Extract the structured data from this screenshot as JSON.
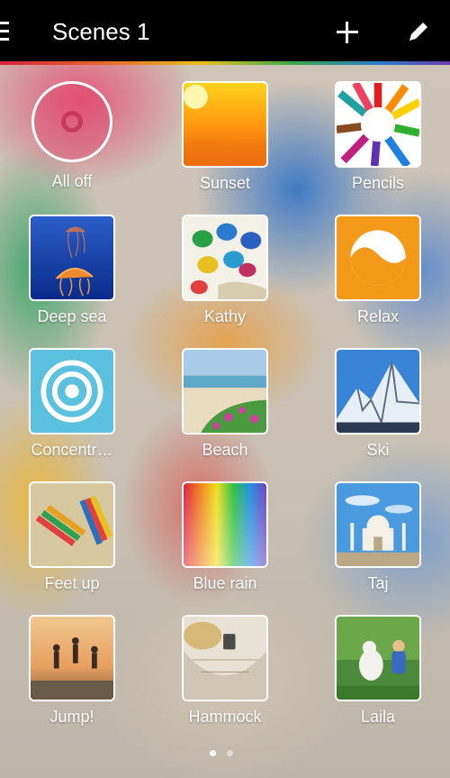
{
  "header": {
    "title": "Scenes 1",
    "icons": [
      "menu-icon",
      "add-icon",
      "edit-icon"
    ]
  },
  "scenes": [
    {
      "label": "All off",
      "icon": "power-off-icon"
    },
    {
      "label": "Sunset",
      "icon": "sunset-image"
    },
    {
      "label": "Pencils",
      "icon": "pencils-image"
    },
    {
      "label": "Deep sea",
      "icon": "jellyfish-image"
    },
    {
      "label": "Kathy",
      "icon": "handprints-image"
    },
    {
      "label": "Relax",
      "icon": "relax-icon"
    },
    {
      "label": "Concentr…",
      "icon": "concentrate-icon"
    },
    {
      "label": "Beach",
      "icon": "beach-image"
    },
    {
      "label": "Ski",
      "icon": "mountain-image"
    },
    {
      "label": "Feet up",
      "icon": "feet-up-image"
    },
    {
      "label": "Blue rain",
      "icon": "rainbow-image"
    },
    {
      "label": "Taj",
      "icon": "taj-image"
    },
    {
      "label": "Jump!",
      "icon": "jump-image"
    },
    {
      "label": "Hammock",
      "icon": "hammock-image"
    },
    {
      "label": "Laila",
      "icon": "dog-image"
    }
  ],
  "pager": {
    "pages": 2,
    "current": 1
  },
  "colors": {
    "header": "#000000",
    "accent_orange": "#f0961e",
    "relax_orange": "#f39a1a",
    "concentrate_blue": "#5cc1df"
  }
}
